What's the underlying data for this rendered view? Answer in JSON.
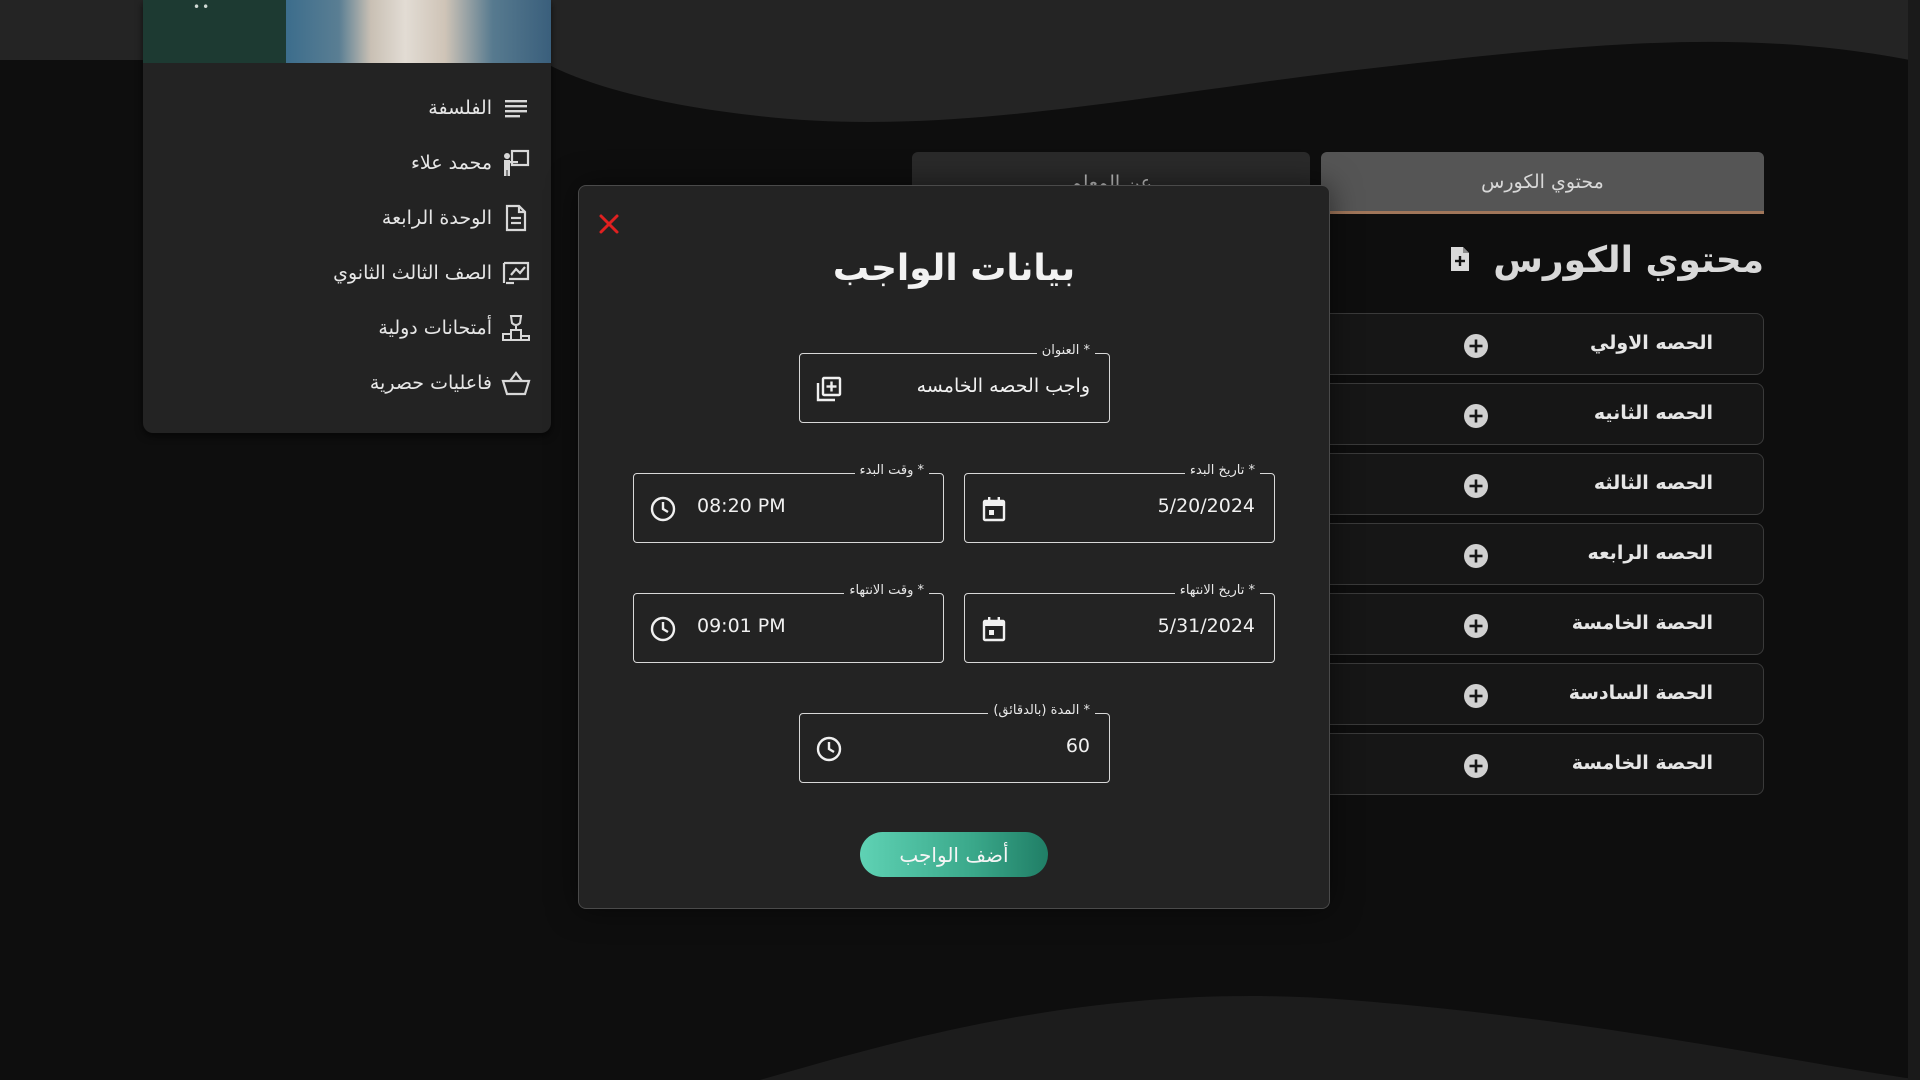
{
  "sidebar": {
    "items": [
      {
        "label": "الفلسفة",
        "icon": "list-icon"
      },
      {
        "label": "محمد علاء",
        "icon": "teacher-icon"
      },
      {
        "label": "الوحدة الرابعة",
        "icon": "document-icon"
      },
      {
        "label": "الصف الثالث الثانوي",
        "icon": "chalkboard-icon"
      },
      {
        "label": "أمتحانات دولية",
        "icon": "trophy-podium-icon"
      },
      {
        "label": "فاعليات حصرية",
        "icon": "basket-icon"
      }
    ]
  },
  "tabs": {
    "about": "عن المعلم",
    "content": "محتوي الكورس"
  },
  "course": {
    "heading": "محتوي الكورس",
    "lessons": [
      {
        "label": "الحصه الاولي"
      },
      {
        "label": "الحصه الثانيه"
      },
      {
        "label": "الحصه الثالثه"
      },
      {
        "label": "الحصه الرابعه"
      },
      {
        "label": "الحصة الخامسة"
      },
      {
        "label": "الحصة السادسة"
      },
      {
        "label": "الحصة الخامسة"
      }
    ]
  },
  "modal": {
    "title": "بيانات الواجب",
    "close_icon": "close-icon",
    "accent_close": "#e02020",
    "fields": {
      "title": {
        "label": "العنوان *",
        "value": "واجب الحصه الخامسه"
      },
      "start_date": {
        "label": "تاريخ البدء *",
        "value": "5/20/2024"
      },
      "start_time": {
        "label": "وقت البدء *",
        "value": "08:20 PM"
      },
      "end_date": {
        "label": "تاريخ الانتهاء *",
        "value": "5/31/2024"
      },
      "end_time": {
        "label": "وقت الانتهاء *",
        "value": "09:01 PM"
      },
      "duration": {
        "label": "المدة (بالدقائق) *",
        "value": "60"
      }
    },
    "submit_label": "أضف الواجب",
    "submit_colors": [
      "#5fd2b4",
      "#207e66"
    ]
  }
}
